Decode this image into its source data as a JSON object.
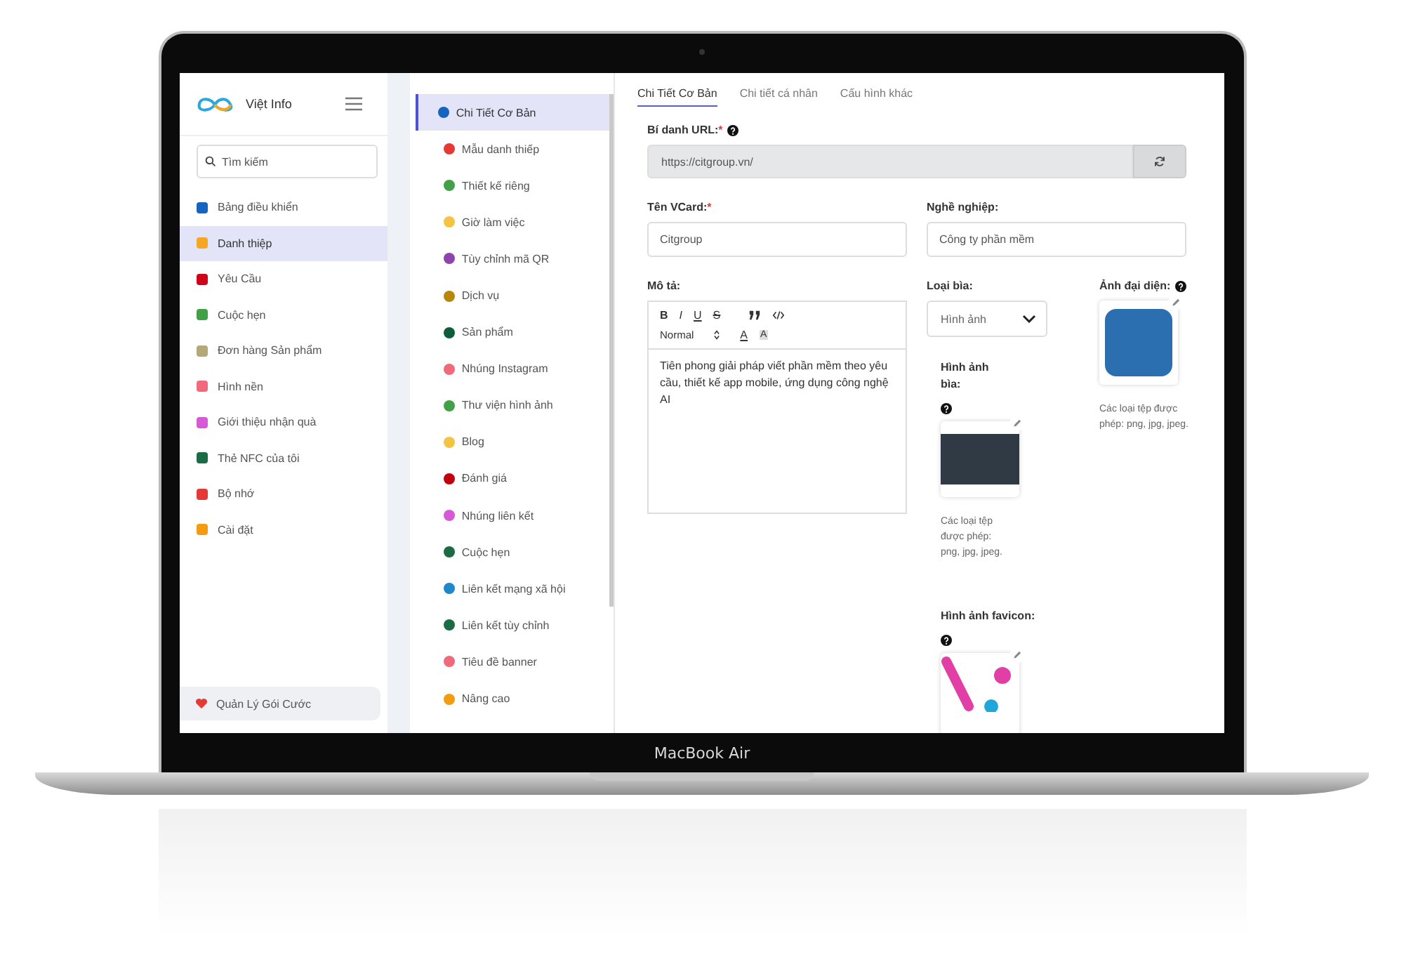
{
  "brand": {
    "name": "Việt Info"
  },
  "search": {
    "placeholder": "Tìm kiếm"
  },
  "sidebar": {
    "items": [
      {
        "label": "Bảng điều khiển",
        "selected": false,
        "color": "#1565c0"
      },
      {
        "label": "Danh thiệp",
        "selected": true,
        "color": "#f5a623"
      },
      {
        "label": "Yêu Cầu",
        "selected": false,
        "color": "#d0021b"
      },
      {
        "label": "Cuộc hẹn",
        "selected": false,
        "color": "#43a047"
      },
      {
        "label": "Đơn hàng Sản phẩm",
        "selected": false,
        "color": "#b5a878"
      },
      {
        "label": "Hình nền",
        "selected": false,
        "color": "#ef6b7b"
      },
      {
        "label": "Giới thiệu nhận quà",
        "selected": false,
        "color": "#d65ad6"
      },
      {
        "label": "Thẻ NFC của tôi",
        "selected": false,
        "color": "#1b6b45"
      },
      {
        "label": "Bộ nhớ",
        "selected": false,
        "color": "#e53935"
      },
      {
        "label": "Cài đặt",
        "selected": false,
        "color": "#f39c12"
      }
    ],
    "footer": "Quản Lý Gói Cước"
  },
  "sections": [
    {
      "label": "Chi Tiết Cơ Bản",
      "selected": true,
      "color": "#1565c0"
    },
    {
      "label": "Mẫu danh thiếp",
      "selected": false,
      "color": "#e53935"
    },
    {
      "label": "Thiết kế riêng",
      "selected": false,
      "color": "#43a047"
    },
    {
      "label": "Giờ làm việc",
      "selected": false,
      "color": "#f5c342"
    },
    {
      "label": "Tùy chỉnh mã QR",
      "selected": false,
      "color": "#8e44ad"
    },
    {
      "label": "Dịch vụ",
      "selected": false,
      "color": "#b8860b"
    },
    {
      "label": "Sản phẩm",
      "selected": false,
      "color": "#0b5d3b"
    },
    {
      "label": "Nhúng Instagram",
      "selected": false,
      "color": "#ef6b7b"
    },
    {
      "label": "Thư viện hình ảnh",
      "selected": false,
      "color": "#43a047"
    },
    {
      "label": "Blog",
      "selected": false,
      "color": "#f5c342"
    },
    {
      "label": "Đánh giá",
      "selected": false,
      "color": "#c0000b"
    },
    {
      "label": "Nhúng liên kết",
      "selected": false,
      "color": "#d65ad6"
    },
    {
      "label": "Cuộc hẹn",
      "selected": false,
      "color": "#1b6b45"
    },
    {
      "label": "Liên kết mạng xã hội",
      "selected": false,
      "color": "#1e88c8"
    },
    {
      "label": "Liên kết tùy chỉnh",
      "selected": false,
      "color": "#1b6b45"
    },
    {
      "label": "Tiêu đề banner",
      "selected": false,
      "color": "#ef6b7b"
    },
    {
      "label": "Nâng cao",
      "selected": false,
      "color": "#f39c12"
    }
  ],
  "tabs": [
    {
      "label": "Chi Tiết Cơ Bản",
      "selected": true
    },
    {
      "label": "Chi tiết cá nhân",
      "selected": false
    },
    {
      "label": "Cấu hình khác",
      "selected": false
    }
  ],
  "url_alias": {
    "label": "Bí danh URL:",
    "required_mark": "*",
    "value": "https://citgroup.vn/"
  },
  "vcard_name": {
    "label": "Tên VCard:",
    "required_mark": "*",
    "value": "Citgroup"
  },
  "occupation": {
    "label": "Nghề nghiệp:",
    "value": "Công ty phần mềm"
  },
  "description": {
    "label": "Mô tả:",
    "toolbar": [
      {
        "kind": "bold",
        "label": "B"
      },
      {
        "kind": "italic",
        "label": "I"
      },
      {
        "kind": "underline",
        "label": "U"
      },
      {
        "kind": "strike",
        "label": "S"
      },
      {
        "kind": "quote"
      },
      {
        "kind": "code"
      }
    ],
    "format": "Normal",
    "color_tools": [
      {
        "kind": "text",
        "label": "A"
      },
      {
        "kind": "background",
        "label": "A"
      }
    ],
    "value": "Tiên phong giải pháp viết phần mềm theo yêu cầu, thiết kế app mobile, ứng dụng công nghệ AI"
  },
  "cover_type": {
    "label": "Loại bìa:",
    "value": "Hình ảnh"
  },
  "avatar": {
    "label": "Ảnh đại diện:",
    "hint": "Các loại tệp được phép: png, jpg, jpeg."
  },
  "cover_image": {
    "label": "Hình ảnh bìa:",
    "hint": "Các loại tệp được phép: png, jpg, jpeg."
  },
  "favicon": {
    "label": "Hình ảnh favicon:"
  },
  "device": {
    "label": "MacBook Air"
  }
}
